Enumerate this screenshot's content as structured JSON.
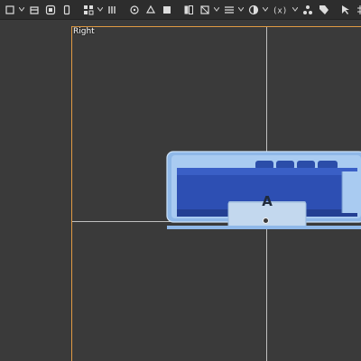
{
  "viewport": {
    "view_name": "Right"
  },
  "model": {
    "key_label": "A"
  },
  "toolbar": {
    "icons": [
      "object-mode-icon",
      "view-icon",
      "select-icon",
      "add-icon",
      "object-icon",
      "viewport-shading-icon",
      "pivot-icon",
      "snap-icon",
      "proportional-editing-icon",
      "overlay-icon",
      "xray-icon",
      "gizmo-icon",
      "shading-icon"
    ]
  },
  "colors": {
    "background": "#3a3a3a",
    "camera_frame": "#e09a43",
    "model_blue": "#2d4fb3",
    "model_light": "#9dc3f0"
  }
}
